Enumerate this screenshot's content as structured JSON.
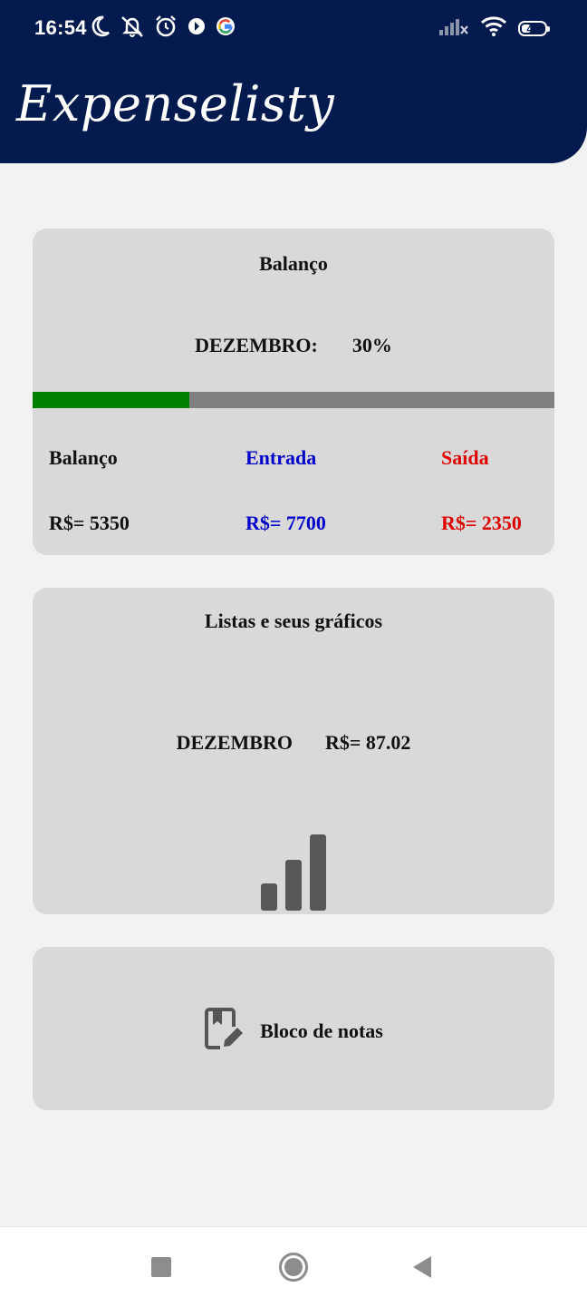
{
  "status_bar": {
    "time": "16:54",
    "battery": "49",
    "battery_level": 0.49
  },
  "app": {
    "title": "Expenselisty"
  },
  "balance_card": {
    "title": "Balanço",
    "month": "DEZEMBRO:",
    "percent": "30%",
    "progress": 0.3,
    "columns": [
      {
        "label": "Balanço",
        "value": "R$= 5350"
      },
      {
        "label": "Entrada",
        "value": "R$= 7700"
      },
      {
        "label": "Saída",
        "value": "R$= 2350"
      }
    ]
  },
  "lists_card": {
    "title": "Listas e seus gráficos",
    "month": "DEZEMBRO",
    "value": "R$= 87.02",
    "icon": "bar-chart-icon"
  },
  "notes_card": {
    "label": "Bloco de notas",
    "icon": "notebook-edit-icon"
  },
  "nav_bar": {
    "icons": [
      "recents-icon",
      "home-icon",
      "back-icon"
    ]
  },
  "colors": {
    "header": "#021a4e",
    "card": "#d9d9d9",
    "progress_fill": "#008000",
    "progress_track": "#808080",
    "income": "#0000cc",
    "expense": "#e00000"
  }
}
